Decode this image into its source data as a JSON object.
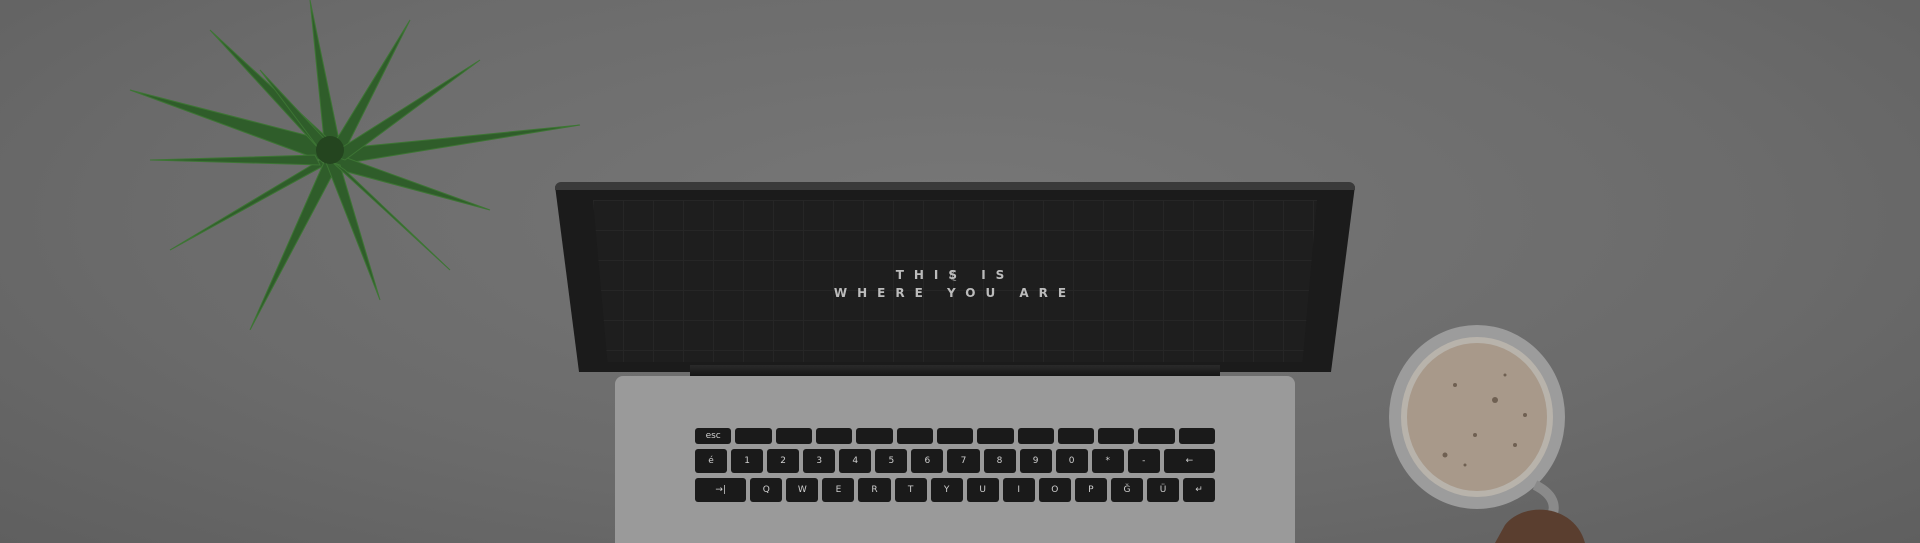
{
  "screen": {
    "line1": "THIS IS",
    "line2": "WHERE YOU ARE"
  },
  "keyboard": {
    "row_fn": [
      "esc",
      "",
      "",
      "",
      "",
      "",
      "",
      "",
      "",
      "",
      "",
      "",
      ""
    ],
    "row_1": [
      "é",
      "1",
      "2",
      "3",
      "4",
      "5",
      "6",
      "7",
      "8",
      "9",
      "0",
      "*",
      "-",
      "←"
    ],
    "row_2": [
      "→|",
      "Q",
      "W",
      "E",
      "R",
      "T",
      "Y",
      "U",
      "I",
      "O",
      "P",
      "Ğ",
      "Ü",
      "↵"
    ]
  }
}
